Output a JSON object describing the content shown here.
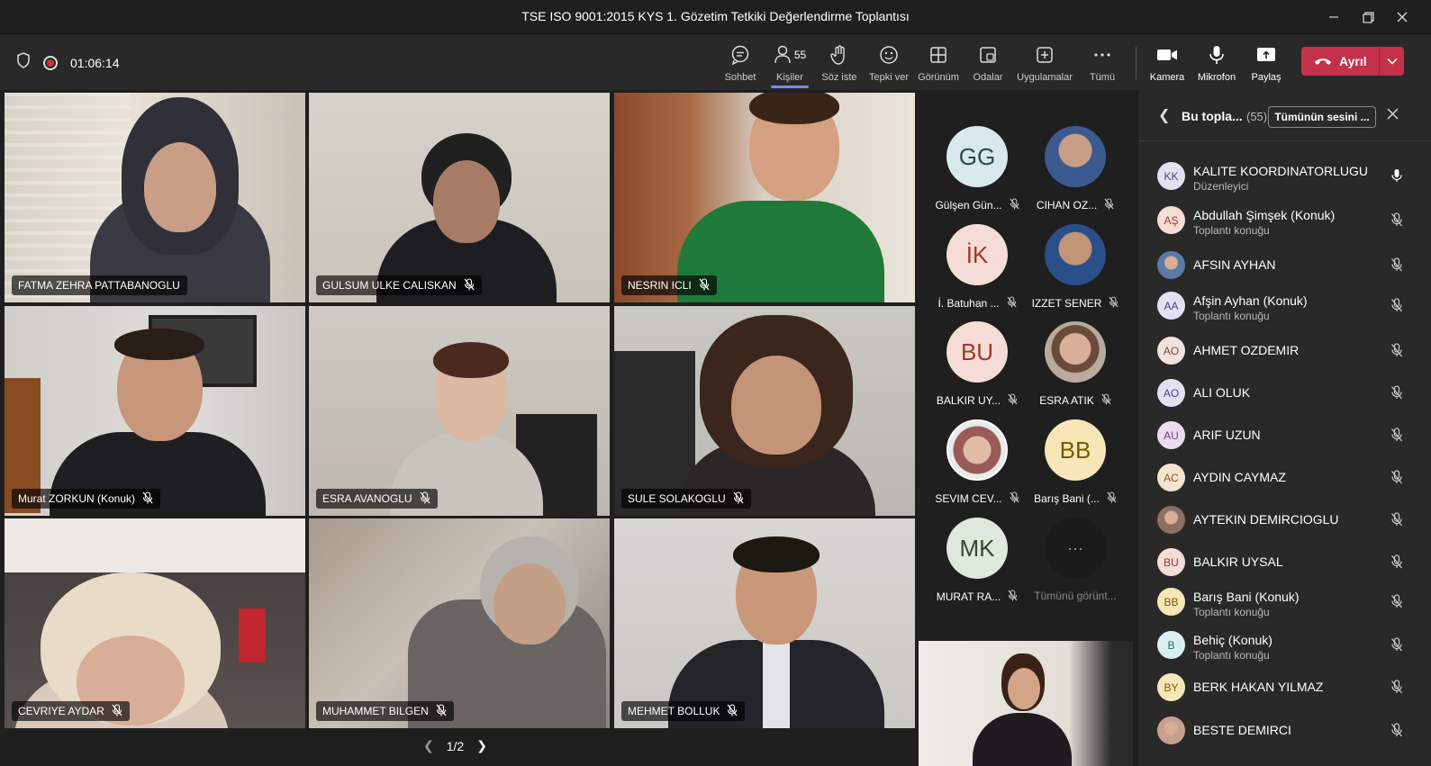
{
  "window": {
    "title": "TSE ISO 9001:2015 KYS 1. Gözetim Tetkiki Değerlendirme Toplantısı"
  },
  "toolbar": {
    "timer": "01:06:14",
    "people_count": "55",
    "items": [
      {
        "label": "Sohbet",
        "icon": "chat-icon"
      },
      {
        "label": "Kişiler",
        "icon": "people-icon"
      },
      {
        "label": "Söz iste",
        "icon": "raise-hand-icon"
      },
      {
        "label": "Tepki ver",
        "icon": "reaction-icon"
      },
      {
        "label": "Görünüm",
        "icon": "view-icon"
      },
      {
        "label": "Odalar",
        "icon": "rooms-icon"
      },
      {
        "label": "Uygulamalar",
        "icon": "apps-icon"
      },
      {
        "label": "Tümü",
        "icon": "more-icon"
      },
      {
        "label": "Kamera",
        "icon": "camera-icon"
      },
      {
        "label": "Mikrofon",
        "icon": "mic-icon"
      },
      {
        "label": "Paylaş",
        "icon": "share-icon"
      }
    ],
    "leave_label": "Ayrıl"
  },
  "grid": {
    "tiles": [
      {
        "name": "FATMA ZEHRA PATTABANOGLU",
        "muted": false
      },
      {
        "name": "GULSUM ULKE CALISKAN",
        "muted": true
      },
      {
        "name": "NESRIN ICLI",
        "muted": true
      },
      {
        "name": "Murat ZORKUN (Konuk)",
        "muted": true
      },
      {
        "name": "ESRA AVANOGLU",
        "muted": true
      },
      {
        "name": "SULE SOLAKOGLU",
        "muted": true
      },
      {
        "name": "CEVRIYE AYDAR",
        "muted": true
      },
      {
        "name": "MUHAMMET BILGEN",
        "muted": true
      },
      {
        "name": "MEHMET BOLLUK",
        "muted": true
      }
    ],
    "pager": "1/2"
  },
  "strip": {
    "avatars": [
      {
        "initials": "GG",
        "name": "Gülşen Gün...",
        "bg": "#d8e8ec",
        "fg": "#2a4a52"
      },
      {
        "initials": "",
        "name": "CIHAN OZ...",
        "bg": "#6a88b0",
        "fg": "#fff"
      },
      {
        "initials": "İK",
        "name": "İ. Batuhan ...",
        "bg": "#f5dcd6",
        "fg": "#a0382a"
      },
      {
        "initials": "",
        "name": "IZZET SENER",
        "bg": "#4a72a8",
        "fg": "#fff"
      },
      {
        "initials": "BU",
        "name": "BALKIR UY...",
        "bg": "#f5dcd6",
        "fg": "#a0382a"
      },
      {
        "initials": "",
        "name": "ESRA ATIK",
        "bg": "#b89a86",
        "fg": "#fff"
      },
      {
        "initials": "",
        "name": "SEVIM CEV...",
        "bg": "#c9b7a8",
        "fg": "#fff"
      },
      {
        "initials": "BB",
        "name": "Barış Bani (...",
        "bg": "#f7e7b8",
        "fg": "#7a5a00"
      },
      {
        "initials": "MK",
        "name": "MURAT RA...",
        "bg": "#dfe8dc",
        "fg": "#2f4a2a"
      },
      {
        "initials": "···",
        "name": "Tümünü görünt...",
        "bg": "#1a1a1a",
        "fg": "#999"
      }
    ]
  },
  "panel": {
    "title": "Bu topla...",
    "count": "(55)",
    "mute_all": "Tümünün sesini ...",
    "participants": [
      {
        "initials": "KK",
        "name": "KALITE KOORDINATORLUGU",
        "sub": "Düzenleyici",
        "bg": "#e4e0f2",
        "fg": "#4a3f8a",
        "mic": "on"
      },
      {
        "initials": "AŞ",
        "name": "Abdullah Şimşek (Konuk)",
        "sub": "Toplantı konuğu",
        "bg": "#f5dcd6",
        "fg": "#a0382a",
        "mic": "off"
      },
      {
        "initials": "",
        "name": "AFSIN AYHAN",
        "sub": "",
        "bg": "#5a7aa8",
        "fg": "#fff",
        "mic": "off"
      },
      {
        "initials": "AA",
        "name": "Afşin Ayhan (Konuk)",
        "sub": "Toplantı konuğu",
        "bg": "#e4e0f2",
        "fg": "#4a3f8a",
        "mic": "off"
      },
      {
        "initials": "AO",
        "name": "AHMET OZDEMIR",
        "sub": "",
        "bg": "#f0e2dc",
        "fg": "#7a4a3a",
        "mic": "off"
      },
      {
        "initials": "AO",
        "name": "ALI OLUK",
        "sub": "",
        "bg": "#e4e0f2",
        "fg": "#4a3f8a",
        "mic": "off"
      },
      {
        "initials": "AU",
        "name": "ARIF UZUN",
        "sub": "",
        "bg": "#ecdcf0",
        "fg": "#7a3a8a",
        "mic": "off"
      },
      {
        "initials": "AC",
        "name": "AYDIN CAYMAZ",
        "sub": "",
        "bg": "#f5e4d0",
        "fg": "#8a5a20",
        "mic": "off"
      },
      {
        "initials": "",
        "name": "AYTEKIN DEMIRCIOGLU",
        "sub": "",
        "bg": "#8a7060",
        "fg": "#fff",
        "mic": "off"
      },
      {
        "initials": "BU",
        "name": "BALKIR UYSAL",
        "sub": "",
        "bg": "#f5dcd6",
        "fg": "#a0382a",
        "mic": "off"
      },
      {
        "initials": "BB",
        "name": "Barış Bani (Konuk)",
        "sub": "Toplantı konuğu",
        "bg": "#f7e7b8",
        "fg": "#7a5a00",
        "mic": "off"
      },
      {
        "initials": "B",
        "name": "Behiç (Konuk)",
        "sub": "Toplantı konuğu",
        "bg": "#d8eef0",
        "fg": "#2a6a72",
        "mic": "off"
      },
      {
        "initials": "BY",
        "name": "BERK HAKAN YILMAZ",
        "sub": "",
        "bg": "#f7e7b8",
        "fg": "#7a5a00",
        "mic": "off"
      },
      {
        "initials": "",
        "name": "BESTE DEMIRCI",
        "sub": "",
        "bg": "#c8a090",
        "fg": "#fff",
        "mic": "off"
      }
    ]
  }
}
